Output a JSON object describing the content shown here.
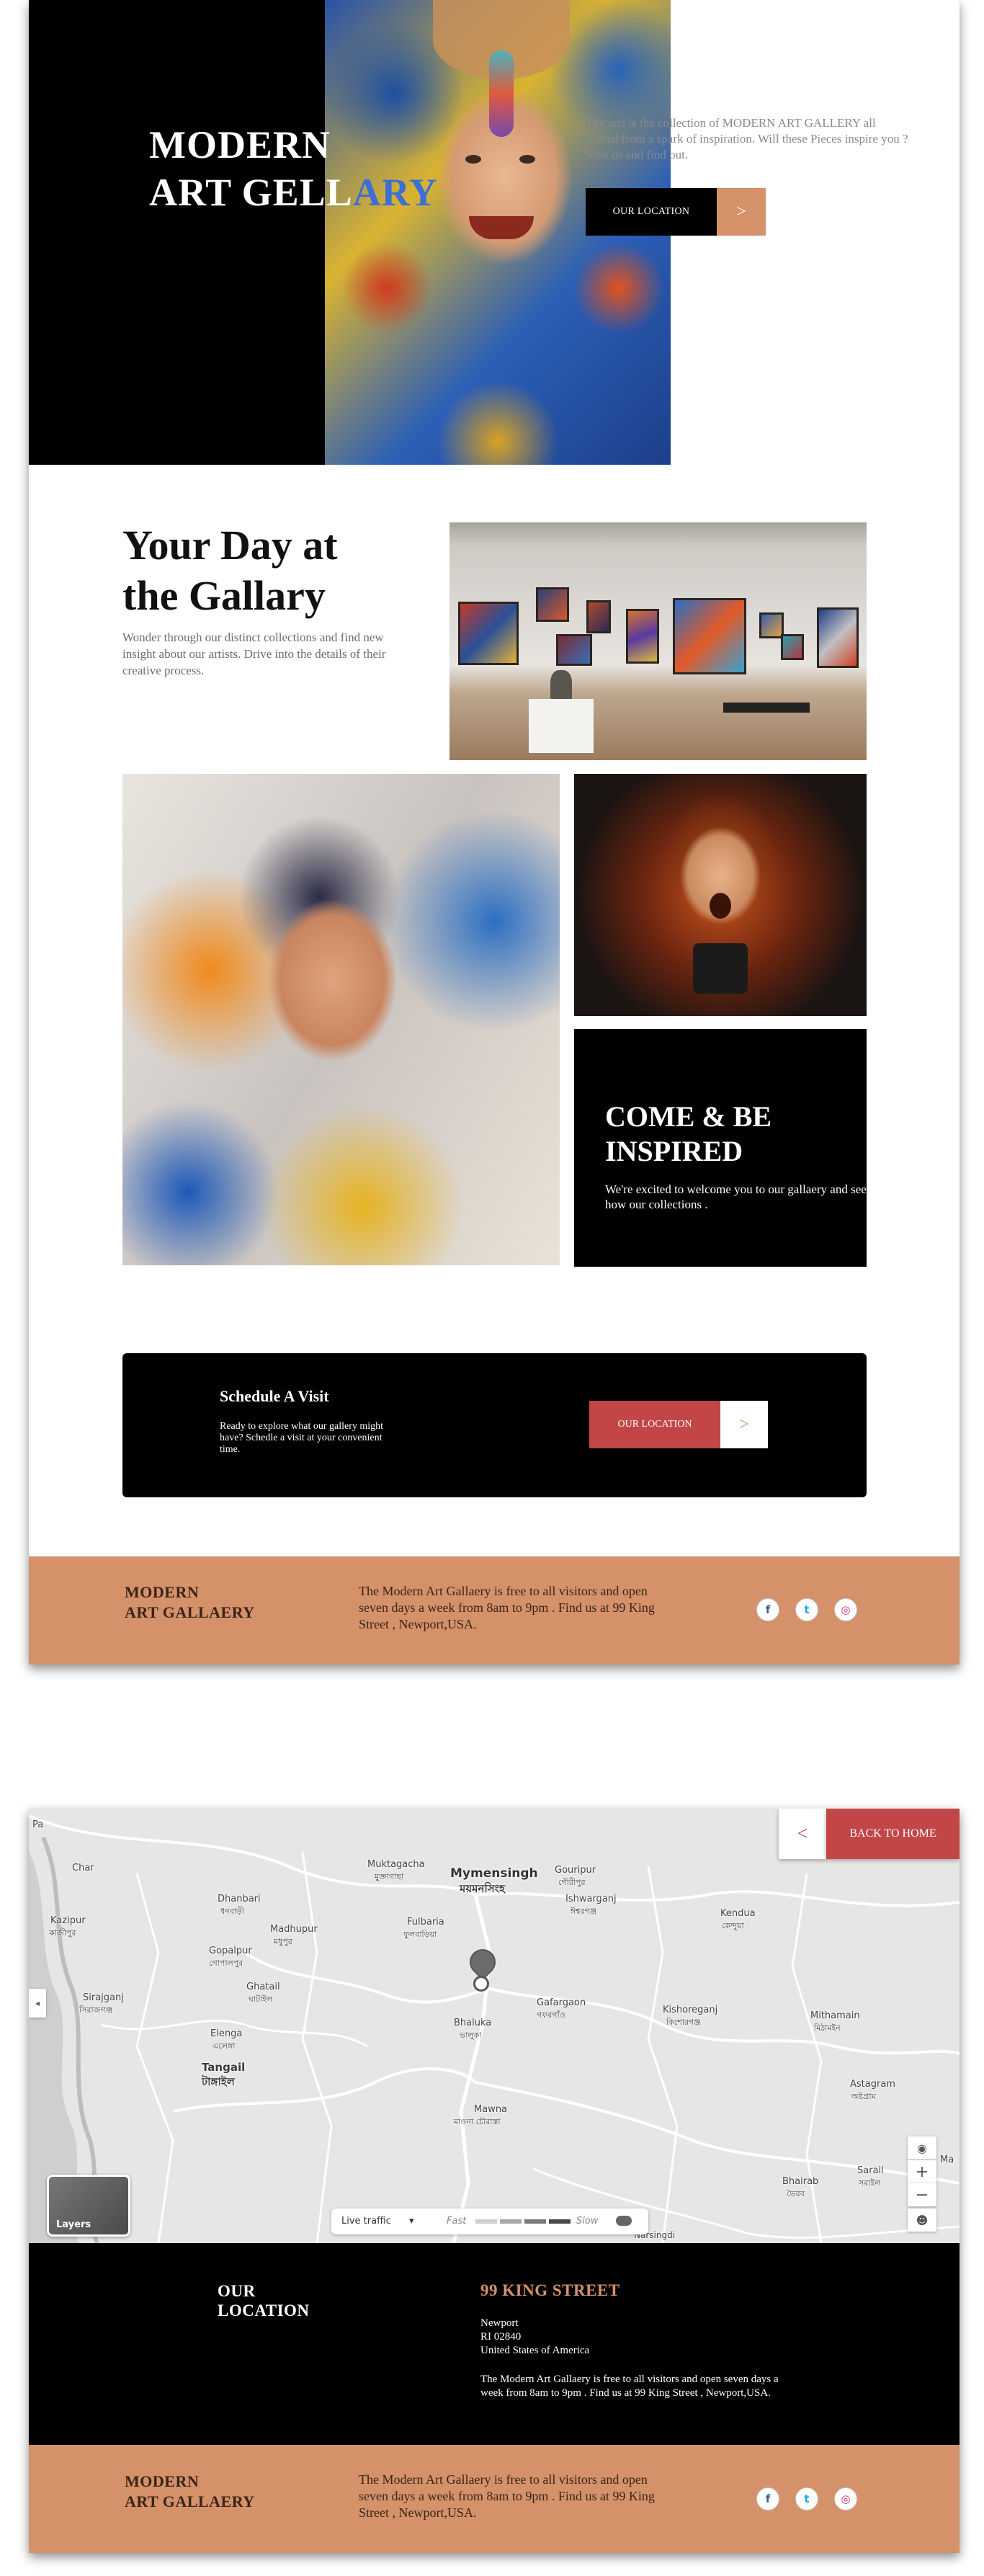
{
  "hero": {
    "title_line1": "MODERN",
    "title_line2_a": "ART GELL",
    "title_line2_b": "ARY",
    "description": "The arts is the collection of MODERN ART GALLERY all started from a spark of inspiration. Will these Pieces inspire you ? Visit us and find out.",
    "button_label": "OUR LOCATION",
    "arrow": ">"
  },
  "gallery_intro": {
    "title_line1": "Your Day at",
    "title_line2": "the Gallary",
    "description": "Wonder through our distinct collections and find new insight about our artists. Drive into the details of their creative process."
  },
  "inspire": {
    "title_line1": "COME & BE",
    "title_line2": "INSPIRED",
    "text": "We're excited to welcome you to our gallaery and see how our collections ."
  },
  "visit": {
    "title": "Schedule A Visit",
    "text": "Ready to explore what our gallery might have? Schedle a visit at your convenient time.",
    "button_label": "OUR LOCATION",
    "arrow": ">"
  },
  "footer": {
    "brand_line1": "MODERN",
    "brand_line2": "ART GALLAERY",
    "text": "The Modern Art Gallaery is free to all visitors and open seven days a week from 8am to 9pm . Find us at 99 King Street , Newport,USA.",
    "social_icons": [
      "facebook-icon",
      "twitter-icon",
      "instagram-icon"
    ],
    "social_glyphs": [
      "f",
      "t",
      "◎"
    ]
  },
  "map": {
    "back_arrow": "<",
    "back_label": "BACK TO HOME",
    "layers_label": "Layers",
    "traffic_label": "Live traffic",
    "traffic_fast": "Fast",
    "traffic_slow": "Slow",
    "zoom_in": "+",
    "zoom_out": "−",
    "labels": {
      "mymensingh": "Mymensingh",
      "mymensingh_bn": "ময়মনসিংহ",
      "muktagacha": "Muktagacha",
      "muktagacha_bn": "মুক্তাগাছা",
      "gouripur": "Gouripur",
      "gouripur_bn": "গৌরীপুর",
      "ishwarganj": "Ishwarganj",
      "ishwarganj_bn": "ঈশ্বরগঞ্জ",
      "kendua": "Kendua",
      "kendua_bn": "কেন্দুয়া",
      "dhanbari": "Dhanbari",
      "dhanbari_bn": "ধনবাড়ী",
      "kazipur": "Kazipur",
      "kazipur_bn": "কাজীপুর",
      "madhupur": "Madhupur",
      "madhupur_bn": "মধুপুর",
      "fulbaria": "Fulbaria",
      "fulbaria_bn": "ফুলবাড়িয়া",
      "gopalpur": "Gopalpur",
      "gopalpur_bn": "গোপালপুর",
      "ghatail": "Ghatail",
      "ghatail_bn": "ঘাটাইল",
      "sirajganj": "Sirajganj",
      "sirajganj_bn": "সিরাজগঞ্জ",
      "elenga": "Elenga",
      "elenga_bn": "এলেঙ্গা",
      "tangail": "Tangail",
      "tangail_bn": "টাঙ্গাইল",
      "gafargaon": "Gafargaon",
      "gafargaon_bn": "গফরগাঁও",
      "kishoreganj": "Kishoreganj",
      "kishoreganj_bn": "কিশোরগঞ্জ",
      "mithamain": "Mithamain",
      "mithamain_bn": "মিঠামইন",
      "bhaluka": "Bhaluka",
      "bhaluka_bn": "ভালুকা",
      "mawna": "Mawna",
      "mawna_bn": "মাওনা চৌরাস্তা",
      "astagram": "Astagram",
      "astagram_bn": "অষ্টগ্রাম",
      "bhairab": "Bhairab",
      "bhairab_bn": "ভৈরব",
      "sarail": "Sarail",
      "sarail_bn": "সরাইল",
      "char": "Char",
      "narsingdi": "Narsingdi",
      "ma": "Ma"
    }
  },
  "location": {
    "title_line1": "OUR",
    "title_line2": "LOCATION",
    "street": "99 KING STREET",
    "city": "Newport",
    "zip": "RI 02840",
    "country": "United States of America",
    "text": "The Modern Art Gallaery is free to all visitors and open seven days a week from 8am to 9pm . Find us at 99 King Street , Newport,USA."
  },
  "colors": {
    "accent_tan": "#d4916a",
    "accent_red": "#c24646",
    "accent_blue": "#3b6fd6",
    "black": "#000000"
  }
}
